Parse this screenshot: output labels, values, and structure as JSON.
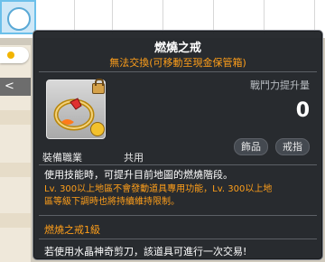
{
  "background": {
    "bar_label": "<"
  },
  "tooltip": {
    "title": "燃燒之戒",
    "subtitle": "無法交換(可移動至現金保管箱)",
    "stat_label": "戰鬥力提升量",
    "stat_value": "0",
    "slot_left": "裝備職業",
    "slot_right": "共用",
    "tags": [
      "飾品",
      "戒指"
    ],
    "desc_main": "使用技能時，可提升目前地圖的燃燒階段。",
    "desc_note_line1": "Lv. 300以上地區不會發動道具專用功能，Lv. 300以上地",
    "desc_note_line2": "區等級下調時也將持續維持限制。",
    "set_name": "燃燒之戒1級",
    "footer": "若使用水晶神奇剪刀，該道具可進行一次交易!"
  },
  "colors": {
    "title": "#ffffff",
    "accent_orange": "#ff9f1a",
    "panel_bg": "#212429"
  }
}
